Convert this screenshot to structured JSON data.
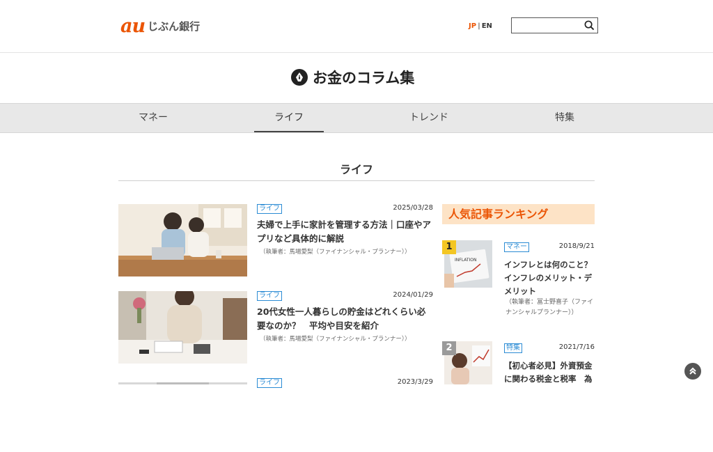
{
  "header": {
    "logo_mark": "au",
    "logo_text": "じぶん銀行",
    "lang_jp": "JP",
    "lang_sep": "|",
    "lang_en": "EN",
    "search_placeholder": ""
  },
  "page_title": "お金のコラム集",
  "tabs": [
    {
      "label": "マネー",
      "active": false
    },
    {
      "label": "ライフ",
      "active": true
    },
    {
      "label": "トレンド",
      "active": false
    },
    {
      "label": "特集",
      "active": false
    }
  ],
  "section_title": "ライフ",
  "articles": [
    {
      "tag": "ライフ",
      "date": "2025/03/28",
      "title": "夫婦で上手に家計を管理する方法｜口座やアプリなど具体的に解説",
      "author": "（執筆者：馬場愛梨（ファイナンシャル・プランナー））"
    },
    {
      "tag": "ライフ",
      "date": "2024/01/29",
      "title": "20代女性一人暮らしの貯金はどれくらい必要なのか？　平均や目安を紹介",
      "author": "（執筆者：馬場愛梨（ファイナンシャル・プランナー））"
    },
    {
      "tag": "ライフ",
      "date": "2023/3/29",
      "title": "",
      "author": ""
    }
  ],
  "ranking": {
    "heading": "人気記事ランキング",
    "items": [
      {
        "rank": "1",
        "tag": "マネー",
        "date": "2018/9/21",
        "title": "インフレとは何のこと？インフレのメリット・デメリット",
        "author": "（執筆者：冨士野喜子（ファイナンシャルプランナー））",
        "thumb_text": "INFLATION"
      },
      {
        "rank": "2",
        "tag": "特集",
        "date": "2021/7/16",
        "title": "【初心者必見】外資預金に関わる税金と税率　為",
        "author": ""
      }
    ]
  },
  "colors": {
    "brand": "#eb5505",
    "tag_blue": "#2a8bd4",
    "rank_bg": "#fde3c6"
  }
}
